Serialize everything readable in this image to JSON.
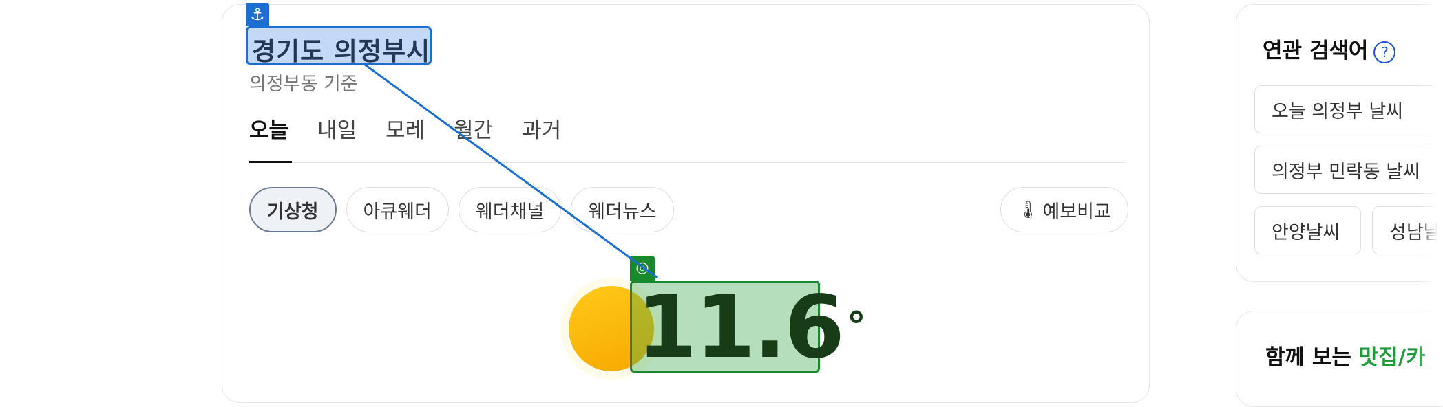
{
  "weather": {
    "location": "경기도 의정부시",
    "basis": "의정부동 기준",
    "tabs": [
      "오늘",
      "내일",
      "모레",
      "월간",
      "과거"
    ],
    "sources": [
      "기상청",
      "아큐웨더",
      "웨더채널",
      "웨더뉴스"
    ],
    "compare_label": "예보비교",
    "temperature": "11.6",
    "degree_symbol": "°"
  },
  "annotations": {
    "anchor_glyph": "⚓",
    "target_glyph": "◎",
    "colors": {
      "anchor": "#1a6fd1",
      "target": "#178a2c"
    }
  },
  "related": {
    "title": "연관 검색어",
    "help_icon": "?",
    "chips": [
      "오늘 의정부 날씨",
      "의정부 민락동 날씨",
      "안양날씨",
      "성남날"
    ]
  },
  "together": {
    "prefix": "함께 보는 ",
    "highlight": "맛집/카"
  }
}
